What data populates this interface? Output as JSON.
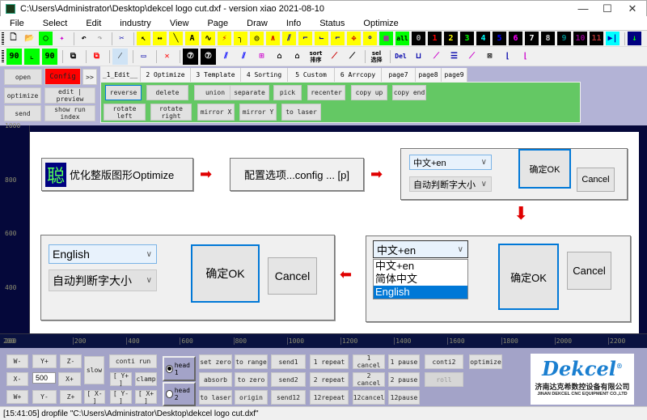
{
  "window": {
    "title": "C:\\Users\\Administrator\\Desktop\\dekcel logo cut.dxf - version xiao 2021-08-10",
    "minimize": "—",
    "maximize": "☐",
    "close": "✕"
  },
  "menu": [
    "File",
    "Select",
    "Edit",
    "industry",
    "View",
    "Page",
    "Draw",
    "Info",
    "Status",
    "Optimize"
  ],
  "toolbar1": [
    {
      "n": "new-file",
      "g": "🗋",
      "bg": "#f0f0f0",
      "c": "#000"
    },
    {
      "n": "open-folder",
      "g": "📂",
      "bg": "#f0f0f0",
      "c": "#a80"
    },
    {
      "n": "green-circle",
      "g": "◯",
      "bg": "#00ff00",
      "c": "#000"
    },
    {
      "n": "open-star",
      "g": "✦",
      "bg": "#f0f0f0",
      "c": "#c0c"
    },
    {
      "sep": 1
    },
    {
      "n": "undo",
      "g": "↶",
      "bg": "#f0f0f0",
      "c": "#000"
    },
    {
      "n": "redo",
      "g": "↷",
      "bg": "#f0f0f0",
      "c": "#aaa"
    },
    {
      "sep": 1
    },
    {
      "n": "cut",
      "g": "✂",
      "bg": "#f0f0f0",
      "c": "#00a"
    },
    {
      "sep": 1
    },
    {
      "n": "select-arrow",
      "g": "↖",
      "bg": "#ffff00",
      "c": "#000"
    },
    {
      "n": "measure",
      "g": "↔",
      "bg": "#ffff00",
      "c": "#000"
    },
    {
      "n": "line",
      "g": "╲",
      "bg": "#ffff00",
      "c": "#000"
    },
    {
      "n": "text",
      "g": "A",
      "bg": "#ffff00",
      "c": "#000"
    },
    {
      "n": "wave",
      "g": "∿",
      "bg": "#ffff00",
      "c": "#000"
    },
    {
      "n": "curve",
      "g": "⚡",
      "bg": "#ffff00",
      "c": "#c00"
    },
    {
      "n": "corner",
      "g": "╮",
      "bg": "#ffff00",
      "c": "#000"
    },
    {
      "n": "circle",
      "g": "◎",
      "bg": "#ffff00",
      "c": "#000"
    },
    {
      "n": "angle",
      "g": "∧",
      "bg": "#ffff00",
      "c": "#c00"
    },
    {
      "n": "slash",
      "g": "⫽",
      "bg": "#ffff00",
      "c": "#00a"
    },
    {
      "n": "node1",
      "g": "⌐",
      "bg": "#ffff00",
      "c": "#00a"
    },
    {
      "n": "node2",
      "g": "⌙",
      "bg": "#ffff00",
      "c": "#00a"
    },
    {
      "n": "node3",
      "g": "⌐",
      "bg": "#ffff00",
      "c": "#00a"
    },
    {
      "n": "move",
      "g": "✥",
      "bg": "#ffff00",
      "c": "#c00"
    },
    {
      "n": "node4",
      "g": "⚬",
      "bg": "#ffff00",
      "c": "#00a"
    },
    {
      "n": "grid",
      "g": "▦",
      "bg": "#00ff00",
      "c": "#c0c"
    },
    {
      "n": "all",
      "g": "all",
      "bg": "#00ff00",
      "c": "#000"
    },
    {
      "n": "layer-0",
      "g": "0",
      "bg": "#000",
      "c": "#aaa"
    },
    {
      "n": "layer-1",
      "g": "1",
      "bg": "#000",
      "c": "#f00"
    },
    {
      "n": "layer-2",
      "g": "2",
      "bg": "#000",
      "c": "#ff0"
    },
    {
      "n": "layer-3",
      "g": "3",
      "bg": "#000",
      "c": "#0f0"
    },
    {
      "n": "layer-4",
      "g": "4",
      "bg": "#000",
      "c": "#0ff"
    },
    {
      "n": "layer-5",
      "g": "5",
      "bg": "#000",
      "c": "#00f"
    },
    {
      "n": "layer-6",
      "g": "6",
      "bg": "#000",
      "c": "#f0f"
    },
    {
      "n": "layer-7",
      "g": "7",
      "bg": "#000",
      "c": "#fff"
    },
    {
      "n": "layer-8",
      "g": "8",
      "bg": "#000",
      "c": "#ccc"
    },
    {
      "n": "layer-9",
      "g": "9",
      "bg": "#000",
      "c": "#088"
    },
    {
      "n": "layer-10",
      "g": "10",
      "bg": "#000",
      "c": "#808"
    },
    {
      "n": "layer-11",
      "g": "11",
      "bg": "#000",
      "c": "#a33"
    },
    {
      "n": "play-end",
      "g": "▶|",
      "bg": "#00ffff",
      "c": "#00a"
    },
    {
      "sep": 1
    },
    {
      "n": "down-arrow",
      "g": "↓",
      "bg": "#000080",
      "c": "#0f0"
    }
  ],
  "toolbar2": [
    {
      "n": "rotate-90-left",
      "g": "90",
      "bg": "#00ff00",
      "c": "#000"
    },
    {
      "n": "corner-l",
      "g": "⌞",
      "bg": "#00ff00",
      "c": "#000"
    },
    {
      "n": "rotate-90-right",
      "g": "90",
      "bg": "#00ff00",
      "c": "#000"
    },
    {
      "sep": 1
    },
    {
      "n": "copy",
      "g": "⧉",
      "bg": "#f0f0f0",
      "c": "#000"
    },
    {
      "sep": 1
    },
    {
      "n": "delete-copy",
      "g": "⧉",
      "bg": "#f0f0f0",
      "c": "#f00"
    },
    {
      "sep": 1
    },
    {
      "n": "split",
      "g": "⁄",
      "bg": "#cfe3f5",
      "c": "#000"
    },
    {
      "sep": 1
    },
    {
      "n": "frame",
      "g": "▭",
      "bg": "#f0f0f0",
      "c": "#00a"
    },
    {
      "sep": 1
    },
    {
      "n": "delete-nodes",
      "g": "✕",
      "bg": "#f0f0f0",
      "c": "#f00"
    },
    {
      "sep": 1
    },
    {
      "n": "circle-7",
      "g": "⑦",
      "bg": "#000",
      "c": "#fff"
    },
    {
      "n": "circle-7b",
      "g": "⑦",
      "bg": "#000",
      "c": "#fff"
    },
    {
      "n": "parallel1",
      "g": "⫽",
      "bg": "#f0f0f0",
      "c": "#00f"
    },
    {
      "n": "parallel2",
      "g": "⫽",
      "bg": "#f0f0f0",
      "c": "#00f"
    },
    {
      "n": "nodes-grid",
      "g": "⊞",
      "bg": "#f0f0f0",
      "c": "#c0c"
    },
    {
      "n": "outline1",
      "g": "⌂",
      "bg": "#f0f0f0",
      "c": "#000"
    },
    {
      "n": "outline2",
      "g": "⌂",
      "bg": "#f0f0f0",
      "c": "#000"
    },
    {
      "n": "sort",
      "g": "sort",
      "bg": "#f0f0f0",
      "c": "#000"
    },
    {
      "n": "curve-a",
      "g": "⟋",
      "bg": "#f0f0f0",
      "c": "#c00"
    },
    {
      "n": "curve-b",
      "g": "⟋",
      "bg": "#f0f0f0",
      "c": "#000"
    },
    {
      "sep": 1
    },
    {
      "n": "sel",
      "g": "sel",
      "bg": "#f0f0f0",
      "c": "#000"
    },
    {
      "sep": 1
    },
    {
      "n": "del",
      "g": "Del",
      "bg": "#f0f0f0",
      "c": "#00a"
    },
    {
      "n": "u-node",
      "g": "⊔",
      "bg": "#f0f0f0",
      "c": "#00a"
    },
    {
      "n": "zigzag",
      "g": "⟋",
      "bg": "#f0f0f0",
      "c": "#c0c"
    },
    {
      "n": "align",
      "g": "☰",
      "bg": "#f0f0f0",
      "c": "#00a"
    },
    {
      "n": "dots",
      "g": "⟋",
      "bg": "#f0f0f0",
      "c": "#c0c"
    },
    {
      "n": "shrink",
      "g": "⊠",
      "bg": "#f0f0f0",
      "c": "#000"
    },
    {
      "n": "lead1",
      "g": "⌊",
      "bg": "#f0f0f0",
      "c": "#00a"
    },
    {
      "n": "lead2",
      "g": "⌊",
      "bg": "#f0f0f0",
      "c": "#c0c"
    }
  ],
  "toolbar2_text": {
    "sort": "sort 排序",
    "sel": "sel 选择"
  },
  "left_buttons": {
    "open": "open",
    "config": "Config",
    "more": ">>",
    "optimize": "optimize",
    "edit_preview": "edit | preview",
    "send": "send",
    "show_run_index": "show run index"
  },
  "tabs": [
    "_1_Edit__",
    "2 Optimize",
    "3 Template",
    "4 Sorting",
    "5 Custom",
    "6 Arrcopy",
    "page7",
    "page8",
    "page9"
  ],
  "edit_buttons_row1": [
    "reverse",
    "delete",
    "union",
    "separate",
    "pick",
    "recenter",
    "copy up",
    "copy end"
  ],
  "edit_buttons_row2": [
    "rotate left",
    "rotate right",
    "mirror X",
    "mirror Y",
    "to laser"
  ],
  "ruler": {
    "x": [
      "200",
      "400",
      "600",
      "800",
      "1000",
      "1200",
      "1400",
      "1600",
      "1800",
      "2000",
      "2200"
    ],
    "y": [
      "1000",
      "800",
      "600",
      "400",
      "200"
    ],
    "corner": "200"
  },
  "canvas": {
    "step1": {
      "icon": "聪",
      "label": "优化整版图形Optimize"
    },
    "step2": {
      "label": "配置选项...config ... [p]"
    },
    "dialog1": {
      "lang": "中文+en",
      "size": "自动判断字大小",
      "ok": "确定OK",
      "cancel": "Cancel"
    },
    "dialog2": {
      "lang": "中文+en",
      "options": [
        "中文+en",
        "简体中文",
        "English"
      ],
      "selected": "English",
      "ok": "确定OK",
      "cancel": "Cancel"
    },
    "dialog3": {
      "lang": "English",
      "size": "自动判断字大小",
      "ok": "确定OK",
      "cancel": "Cancel"
    }
  },
  "bottom": {
    "jog": {
      "w_minus": "W-",
      "y_plus": "Y+",
      "z_minus": "Z-",
      "x_minus": "X-",
      "speed": "500",
      "x_plus": "X+",
      "w_plus": "W+",
      "y_minus": "Y-",
      "z_plus": "Z+",
      "slow": "slow"
    },
    "conti_run": "conti run",
    "y_plus_b": "[ Y+ ]",
    "clamp": "clamp",
    "x_minus_b": "[ X- ]",
    "y_minus_b": "[ Y- ]",
    "x_plus_b": "[ X+ ]",
    "head1": "head 1",
    "head2": "head 2",
    "head_selected": "head 1",
    "grid": [
      [
        "set zero",
        "to range",
        "send1",
        "1 repeat",
        "1 cancel",
        "1 pause"
      ],
      [
        "absorb",
        "to zero",
        "send2",
        "2 repeat",
        "2 cancel",
        "2 pause"
      ],
      [
        "to laser",
        "origin",
        "send12",
        "12repeat",
        "12cancel",
        "12pause"
      ]
    ],
    "conti2": "conti2",
    "optimize": "optimize",
    "roll": "roll"
  },
  "logo": {
    "brand": "Dekcel",
    "reg": "®",
    "cn": "济南达克希数控设备有限公司",
    "en": "JINAN DEKCEL CNC EQUIPMENT CO.,LTD"
  },
  "status": "[15:41:05]  dropfile \"C:\\Users\\Administrator\\Desktop\\dekcel logo cut.dxf\"",
  "colors": {
    "config": "#ff0000",
    "edit_panel": "#64c864",
    "workarea": "#05083a",
    "panel": "#b3b3d6"
  }
}
